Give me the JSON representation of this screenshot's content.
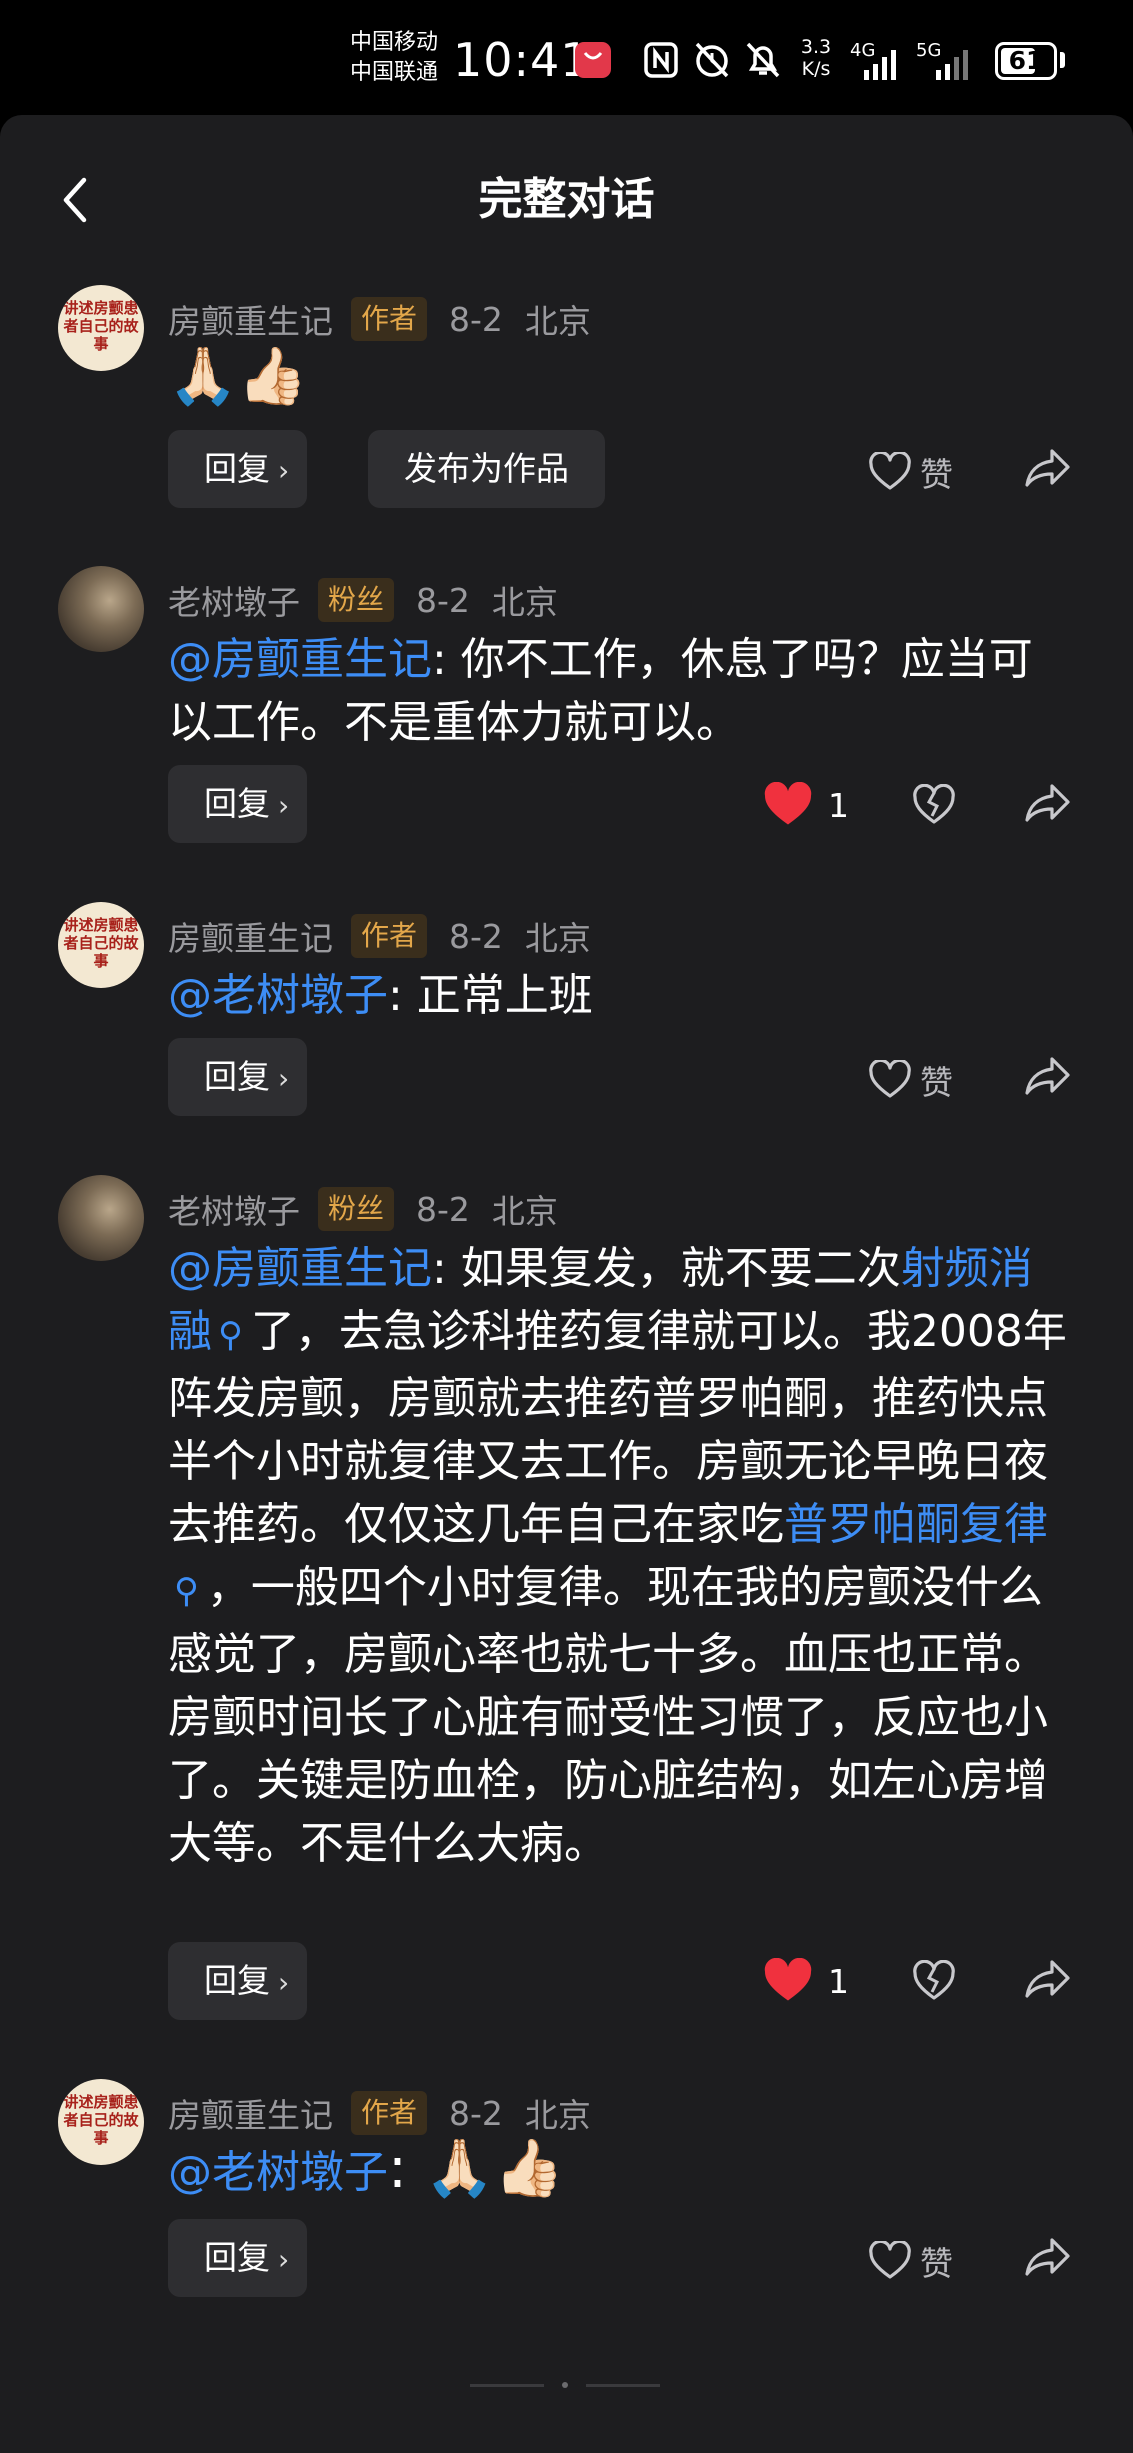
{
  "status_bar": {
    "carrier_1": "中国移动",
    "carrier_2": "中国联通",
    "time": "10:41",
    "net_speed_value": "3.3",
    "net_speed_unit": "K/s",
    "signal_1": "4G",
    "signal_2": "5G",
    "battery": "61",
    "icons": [
      "huawei-appgallery-icon",
      "nfc-icon",
      "alarm-off-icon",
      "bell-off-icon"
    ]
  },
  "header": {
    "title": "完整对话",
    "back_icon": "chevron-left-icon"
  },
  "labels": {
    "reply": "回复",
    "publish": "发布为作品",
    "like": "赞"
  },
  "comments": [
    {
      "user": "房颤重生记",
      "avatar_text": "讲述房颤患者自己的故事",
      "badge": "作者",
      "date": "8-2",
      "location": "北京",
      "content": "🙏🏻👍🏻",
      "likes": null
    },
    {
      "user": "老树墩子",
      "badge": "粉丝",
      "date": "8-2",
      "location": "北京",
      "mention": "@房颤重生记",
      "content": ": 你不工作，休息了吗？应当可以工作。不是重体力就可以。",
      "likes": "1"
    },
    {
      "user": "房颤重生记",
      "avatar_text": "讲述房颤患者自己的故事",
      "badge": "作者",
      "date": "8-2",
      "location": "北京",
      "mention": "@老树墩子",
      "content": ": 正常上班",
      "likes": null
    },
    {
      "user": "老树墩子",
      "badge": "粉丝",
      "date": "8-2",
      "location": "北京",
      "mention": "@房颤重生记",
      "content_1": ": 如果复发，就不要二次",
      "link_1": "射频消融",
      "content_2": "了，去急诊科推药复律就可以。我2008年阵发房颤，房颤就去推药普罗帕酮，推药快点半个小时就复律又去工作。房颤无论早晚日夜去推药。仅仅这几年自己在家吃",
      "link_2": "普罗帕酮复律",
      "content_3": "，一般四个小时复律。现在我的房颤没什么感觉了，房颤心率也就七十多。血压也正常。房颤时间长了心脏有耐受性习惯了，反应也小了。关键是防血栓，防心脏结构，如左心房增大等。不是什么大病。",
      "likes": "1"
    },
    {
      "user": "房颤重生记",
      "avatar_text": "讲述房颤患者自己的故事",
      "badge": "作者",
      "date": "8-2",
      "location": "北京",
      "mention": "@老树墩子",
      "content": ": 🙏🏻👍🏻",
      "likes": null
    }
  ],
  "colors": {
    "background": "#1d1d1f",
    "mention_blue": "#3d8df5",
    "author_badge": "#e3a74a",
    "liked_red": "#f0313e"
  }
}
